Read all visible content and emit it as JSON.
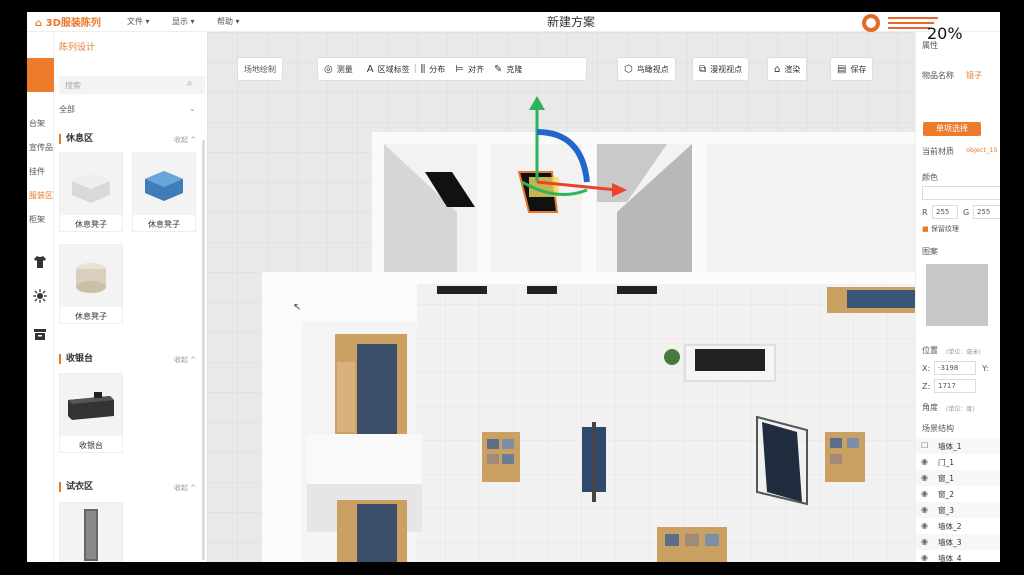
{
  "app": {
    "logo_text": "3D服装陈列",
    "title": "新建方案",
    "zoom": "20%"
  },
  "menu": [
    "文件 ▾",
    "显示 ▾",
    "帮助 ▾"
  ],
  "left_rail": {
    "categories": [
      "台架",
      "宣传品",
      "挂件",
      "服装区",
      "柜架"
    ],
    "active": "服装区"
  },
  "left_panel": {
    "title": "陈列设计",
    "search_placeholder": "搜索",
    "filter": "全部",
    "sections": [
      {
        "name": "休息区",
        "collapse": "收起 ^",
        "items": [
          "休息凳子",
          "休息凳子",
          "休息凳子"
        ]
      },
      {
        "name": "收银台",
        "collapse": "收起 ^",
        "items": [
          "收银台"
        ]
      },
      {
        "name": "试衣区",
        "collapse": "收起 ^",
        "items": [
          "镜子"
        ]
      }
    ]
  },
  "toolbar": {
    "venue": "场地绘制",
    "measure": "测量",
    "area_label": "区域标签",
    "distribute": "分布",
    "align": "对齐",
    "clone": "克隆",
    "bird_view": "鸟瞰视点",
    "roam_view": "漫视视点",
    "render": "渲染",
    "save": "保存"
  },
  "right_panel": {
    "attr_header": "属性",
    "item_name_label": "物品名称",
    "item_name": "镜子",
    "select_btn": "单项选择",
    "material_label": "当前材质",
    "material_value": "object_15",
    "color_label": "颜色",
    "r_label": "R",
    "r_value": "255",
    "g_label": "G",
    "g_value": "255",
    "keep_texture": "保留纹理",
    "pattern_label": "图案",
    "position_label": "位置",
    "position_unit": "(单位：毫米)",
    "x_label": "X:",
    "x_value": "-3198",
    "y_label": "Y:",
    "z_label": "Z:",
    "z_value": "1717",
    "rotate_label": "角度",
    "rotate_unit": "(单位：度)",
    "scene_header": "场景结构",
    "scene_items": [
      "墙体_1",
      "门_1",
      "窗_1",
      "窗_2",
      "窗_3",
      "墙体_2",
      "墙体_3",
      "墙体_4"
    ]
  },
  "colors": {
    "accent": "#ee7a2b"
  }
}
